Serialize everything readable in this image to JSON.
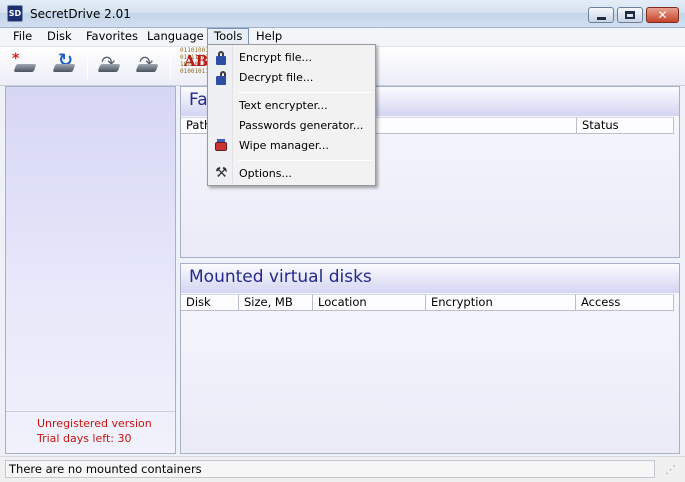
{
  "window": {
    "title": "SecretDrive 2.01",
    "icon_text": "SD"
  },
  "menubar": {
    "items": [
      {
        "label": "File"
      },
      {
        "label": "Disk"
      },
      {
        "label": "Favorites"
      },
      {
        "label": "Language"
      },
      {
        "label": "Tools",
        "active": true
      },
      {
        "label": "Help"
      }
    ]
  },
  "toolbar": {
    "buttons": [
      {
        "icon": "new-disk-icon"
      },
      {
        "icon": "refresh-disk-icon"
      },
      {
        "icon": "mount-disk-icon"
      },
      {
        "icon": "unmount-disk-icon"
      },
      {
        "icon": "encryption-abc-icon"
      }
    ],
    "abc_binary_lines": [
      "0110100110",
      "0101100101",
      "1001011001",
      "01001011"
    ],
    "abc_letters": "ABC"
  },
  "tools_menu": {
    "items": [
      {
        "label": "Encrypt file...",
        "icon": "lock-closed-icon"
      },
      {
        "label": "Decrypt file...",
        "icon": "lock-open-icon"
      },
      {
        "label": "Text encrypter...",
        "icon": ""
      },
      {
        "label": "Passwords generator...",
        "icon": ""
      },
      {
        "label": "Wipe manager...",
        "icon": "wipe-icon"
      },
      {
        "label": "Options...",
        "icon": "tools-icon"
      }
    ]
  },
  "left_pane": {
    "unregistered": "Unregistered version",
    "trial": "Trial days left: 30"
  },
  "favorites_panel": {
    "title": "Favorites",
    "columns": [
      "Path",
      "Status"
    ]
  },
  "mounted_panel": {
    "title": "Mounted virtual disks",
    "columns": [
      "Disk",
      "Size, MB",
      "Location",
      "Encryption",
      "Access"
    ]
  },
  "statusbar": {
    "text": "There are no mounted containers"
  },
  "colors": {
    "panel_title": "#232a8a",
    "warning_text": "#c8140f",
    "left_pane": "#d6d6f5"
  }
}
